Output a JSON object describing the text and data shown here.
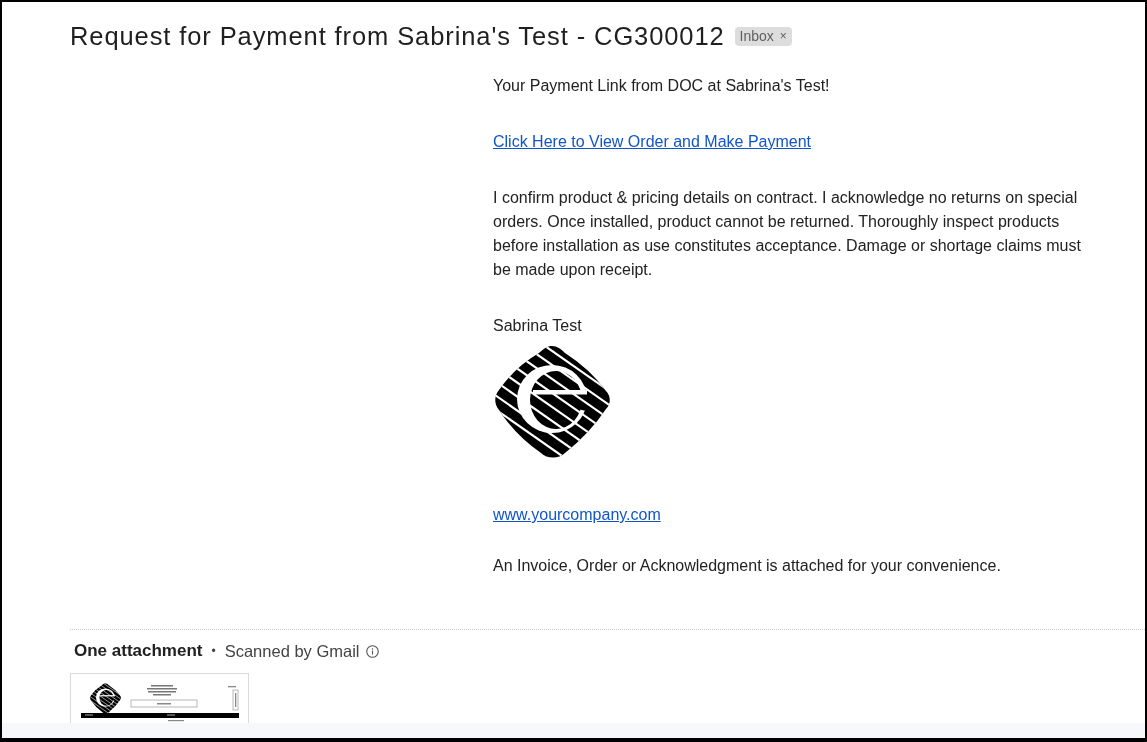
{
  "email": {
    "subject": "Request for Payment from Sabrina's Test - CG300012",
    "label": {
      "text": "Inbox",
      "remove": "×"
    }
  },
  "message": {
    "greeting": "Your Payment Link from DOC at Sabrina's Test!",
    "payment_link": "Click Here to View Order and Make Payment",
    "terms": "I confirm product & pricing details on contract. I acknowledge no returns on special orders. Once installed, product cannot be returned. Thoroughly inspect products before installation as use constitutes acceptance. Damage or shortage claims must be made upon receipt.",
    "signature_name": "Sabrina Test",
    "website_link": "www.yourcompany.com",
    "closing": "An Invoice, Order or Acknowledgment is attached for your convenience."
  },
  "attachments": {
    "heading": "One attachment",
    "separator": "•",
    "scan_note": "Scanned by Gmail"
  }
}
